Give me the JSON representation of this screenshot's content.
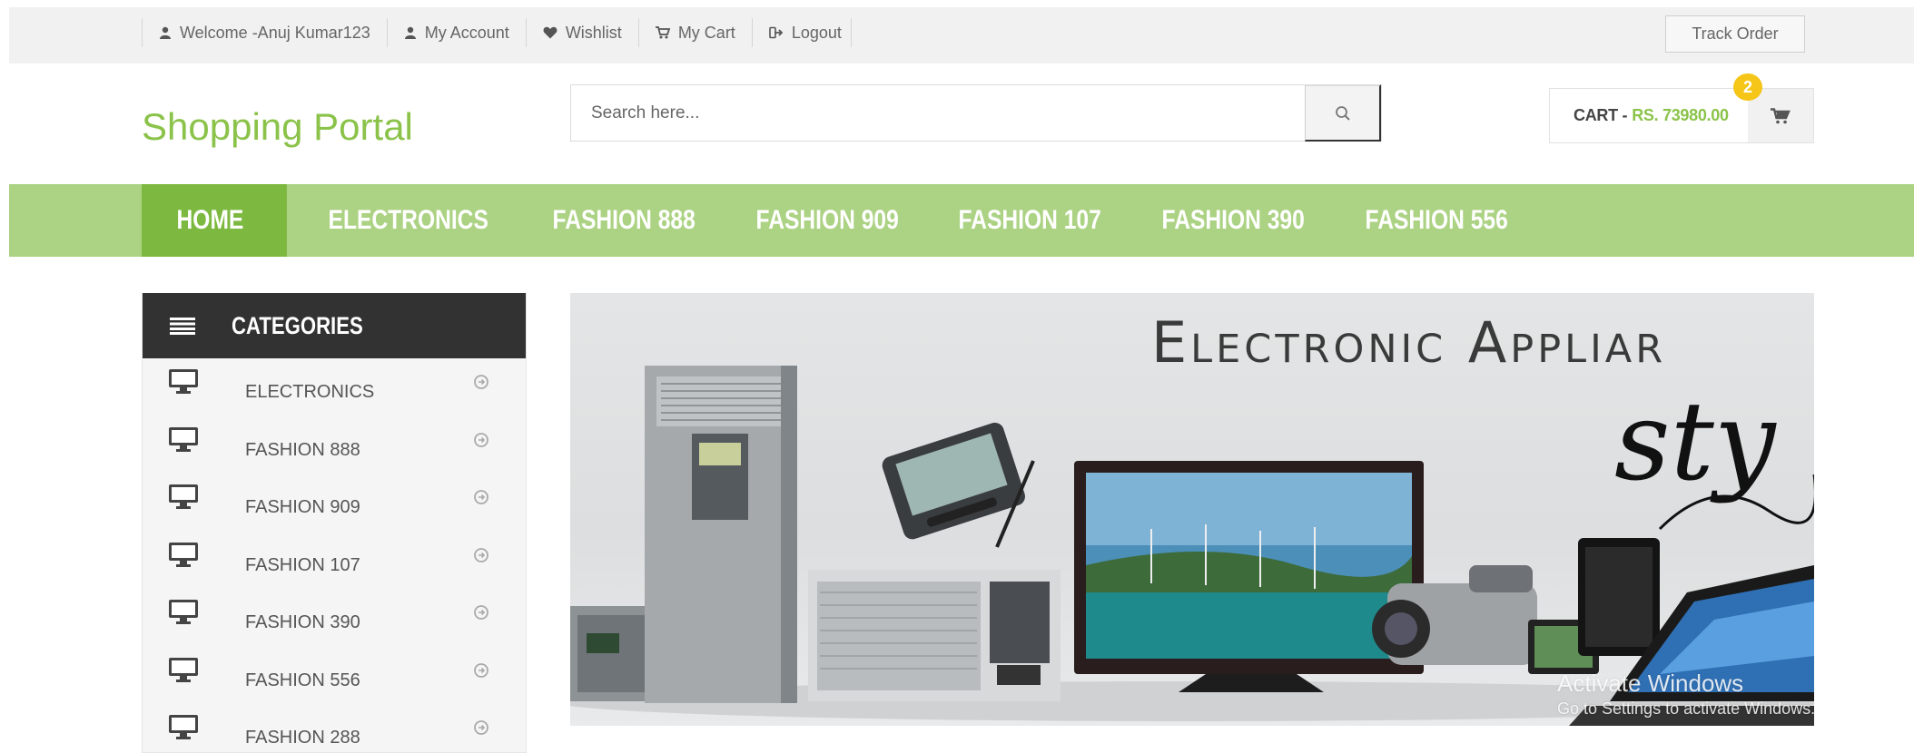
{
  "topbar": {
    "links": [
      {
        "label": "Welcome -Anuj Kumar123",
        "icon": "user-icon"
      },
      {
        "label": "My Account",
        "icon": "user-icon"
      },
      {
        "label": "Wishlist",
        "icon": "heart-icon"
      },
      {
        "label": "My Cart",
        "icon": "cart-icon"
      },
      {
        "label": "Logout",
        "icon": "sign-out-icon"
      }
    ],
    "track_order": "Track Order"
  },
  "header": {
    "logo": "Shopping Portal",
    "search_placeholder": "Search here...",
    "cart_label": "CART -",
    "cart_amount": "RS. 73980.00",
    "cart_count": "2"
  },
  "nav": {
    "items": [
      "HOME",
      "ELECTRONICS",
      "FASHION 888",
      "FASHION 909",
      "FASHION 107",
      "FASHION 390",
      "FASHION 556"
    ],
    "active": "HOME"
  },
  "sidebar": {
    "title": "CATEGORIES",
    "categories": [
      "ELECTRONICS",
      "FASHION 888",
      "FASHION 909",
      "FASHION 107",
      "FASHION 390",
      "FASHION 556",
      "FASHION 288"
    ]
  },
  "banner": {
    "title": "Electronic Appliar",
    "script": "sty"
  },
  "watermark": {
    "line1": "Activate Windows",
    "line2": "Go to Settings to activate Windows."
  },
  "colors": {
    "accent": "#8bc34a",
    "nav_bg": "#acd283",
    "nav_active": "#7db940",
    "badge": "#f5c518",
    "sidebar_head": "#323232"
  }
}
